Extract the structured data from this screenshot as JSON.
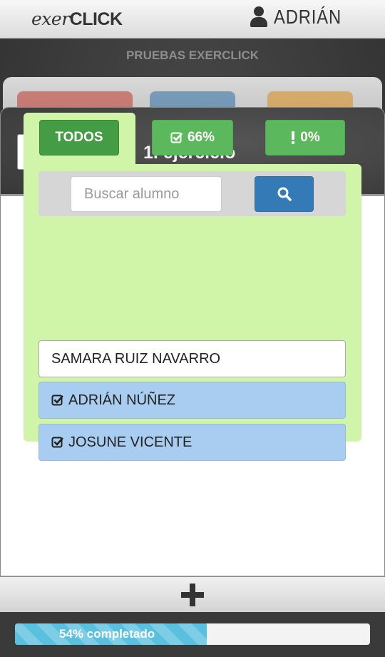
{
  "app": {
    "logo_part1": "exer",
    "logo_part2": "CLICK",
    "user_name": "ADRIÁN"
  },
  "page": {
    "subtitle": "PRUEBAS EXERCLICK"
  },
  "modal": {
    "title": "1. ejercicio",
    "tabs": [
      {
        "label": "TODOS",
        "icon": "none"
      },
      {
        "label": "66%",
        "icon": "check-square-icon"
      },
      {
        "label": "0%",
        "icon": "exclamation-icon"
      }
    ],
    "search": {
      "placeholder": "Buscar alumno",
      "value": ""
    },
    "students": [
      {
        "name": "SAMARA RUIZ NAVARRO",
        "checked": false
      },
      {
        "name": "ADRIÁN NÚÑEZ",
        "checked": true
      },
      {
        "name": "JOSUNE VICENTE",
        "checked": true
      }
    ]
  },
  "progress": {
    "value": 0.54,
    "label": "54% completado"
  },
  "colors": {
    "success": "#5cb85c",
    "success_dark": "#449d44",
    "primary": "#337ab7",
    "panel_bg": "#d1f5a8",
    "checked_row": "#a8cdf0",
    "progress_bar": "#5bc0de"
  }
}
